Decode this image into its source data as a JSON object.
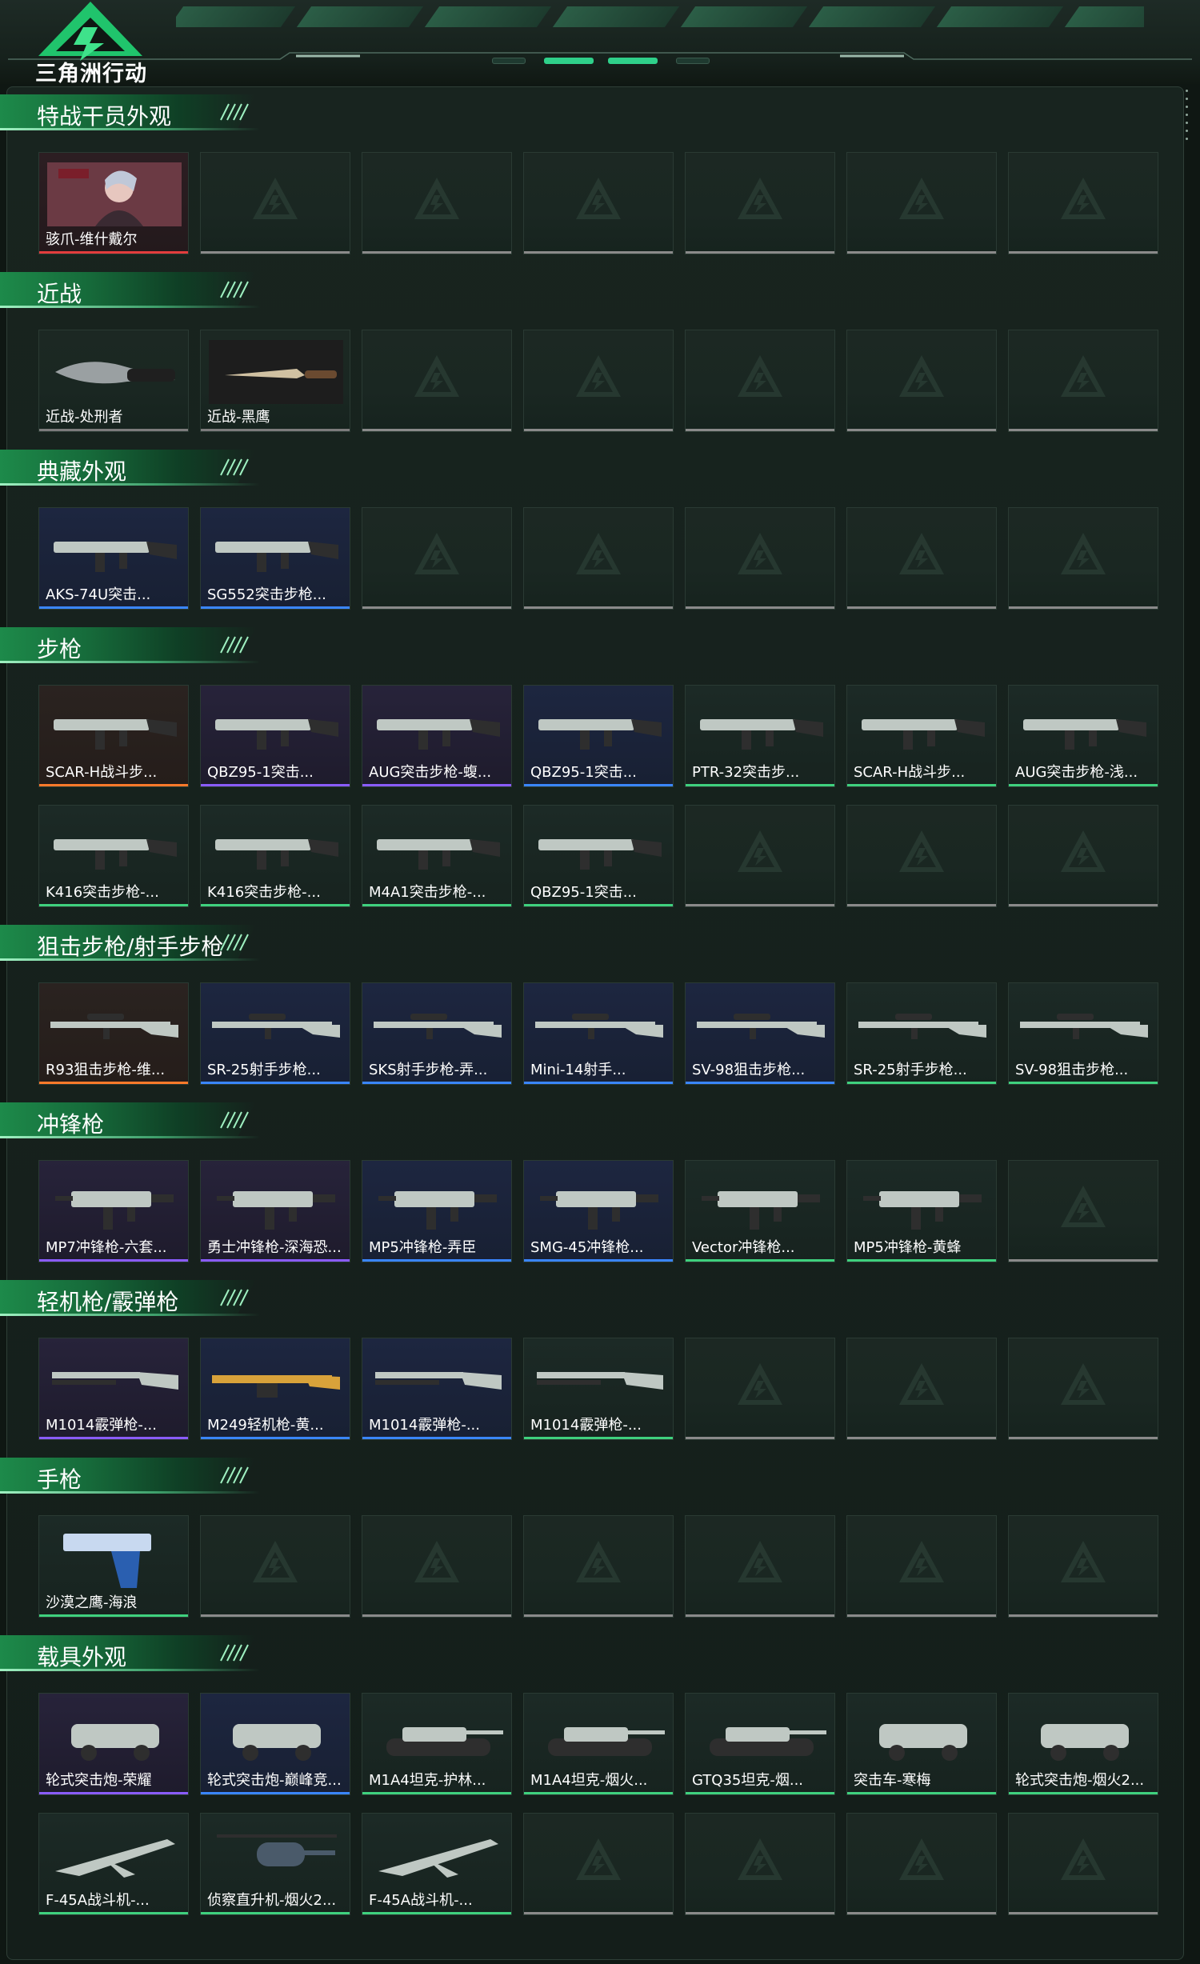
{
  "app": {
    "logo_text": "三角洲行动",
    "accent": "#2fd08a"
  },
  "sections": [
    {
      "title": "特战干员外观",
      "rows": [
        [
          {
            "name": "骇爪-维什戴尔",
            "quality": "red",
            "icon": "operator-portrait"
          },
          null,
          null,
          null,
          null,
          null,
          null
        ]
      ]
    },
    {
      "title": "近战",
      "rows": [
        [
          {
            "name": "近战-处刑者",
            "quality": "none",
            "icon": "melee-blade"
          },
          {
            "name": "近战-黑鹰",
            "quality": "none",
            "icon": "knife"
          },
          null,
          null,
          null,
          null,
          null
        ]
      ]
    },
    {
      "title": "典藏外观",
      "rows": [
        [
          {
            "name": "AKS-74U突击...",
            "quality": "blue",
            "icon": "rifle"
          },
          {
            "name": "SG552突击步枪...",
            "quality": "blue",
            "icon": "rifle"
          },
          null,
          null,
          null,
          null,
          null
        ]
      ]
    },
    {
      "title": "步枪",
      "rows": [
        [
          {
            "name": "SCAR-H战斗步...",
            "quality": "orange",
            "icon": "rifle"
          },
          {
            "name": "QBZ95-1突击...",
            "quality": "purple",
            "icon": "rifle"
          },
          {
            "name": "AUG突击步枪-蝮...",
            "quality": "purple",
            "icon": "rifle"
          },
          {
            "name": "QBZ95-1突击...",
            "quality": "blue",
            "icon": "rifle"
          },
          {
            "name": "PTR-32突击步...",
            "quality": "green",
            "icon": "rifle"
          },
          {
            "name": "SCAR-H战斗步...",
            "quality": "green",
            "icon": "rifle"
          },
          {
            "name": "AUG突击步枪-浅...",
            "quality": "green",
            "icon": "rifle"
          }
        ],
        [
          {
            "name": "K416突击步枪-...",
            "quality": "green",
            "icon": "rifle"
          },
          {
            "name": "K416突击步枪-...",
            "quality": "green",
            "icon": "rifle"
          },
          {
            "name": "M4A1突击步枪-...",
            "quality": "green",
            "icon": "rifle"
          },
          {
            "name": "QBZ95-1突击...",
            "quality": "green",
            "icon": "rifle"
          },
          null,
          null,
          null
        ]
      ]
    },
    {
      "title": "狙击步枪/射手步枪",
      "rows": [
        [
          {
            "name": "R93狙击步枪-维...",
            "quality": "orange",
            "icon": "sniper"
          },
          {
            "name": "SR-25射手步枪...",
            "quality": "blue",
            "icon": "sniper"
          },
          {
            "name": "SKS射手步枪-弄...",
            "quality": "blue",
            "icon": "sniper"
          },
          {
            "name": "Mini-14射手...",
            "quality": "blue",
            "icon": "sniper"
          },
          {
            "name": "SV-98狙击步枪...",
            "quality": "blue",
            "icon": "sniper"
          },
          {
            "name": "SR-25射手步枪...",
            "quality": "green",
            "icon": "sniper"
          },
          {
            "name": "SV-98狙击步枪...",
            "quality": "green",
            "icon": "sniper"
          }
        ]
      ]
    },
    {
      "title": "冲锋枪",
      "rows": [
        [
          {
            "name": "MP7冲锋枪-六套...",
            "quality": "purple",
            "icon": "smg"
          },
          {
            "name": "勇士冲锋枪-深海恐...",
            "quality": "purple",
            "icon": "smg"
          },
          {
            "name": "MP5冲锋枪-弄臣",
            "quality": "blue",
            "icon": "smg"
          },
          {
            "name": "SMG-45冲锋枪...",
            "quality": "blue",
            "icon": "smg"
          },
          {
            "name": "Vector冲锋枪...",
            "quality": "green",
            "icon": "smg"
          },
          {
            "name": "MP5冲锋枪-黄蜂",
            "quality": "green",
            "icon": "smg"
          },
          null
        ]
      ]
    },
    {
      "title": "轻机枪/霰弹枪",
      "rows": [
        [
          {
            "name": "M1014霰弹枪-...",
            "quality": "purple",
            "icon": "shotgun"
          },
          {
            "name": "M249轻机枪-黄...",
            "quality": "blue",
            "icon": "lmg"
          },
          {
            "name": "M1014霰弹枪-...",
            "quality": "blue",
            "icon": "shotgun"
          },
          {
            "name": "M1014霰弹枪-...",
            "quality": "green",
            "icon": "shotgun"
          },
          null,
          null,
          null
        ]
      ]
    },
    {
      "title": "手枪",
      "rows": [
        [
          {
            "name": "沙漠之鹰-海浪",
            "quality": "green",
            "icon": "pistol"
          },
          null,
          null,
          null,
          null,
          null,
          null
        ]
      ]
    },
    {
      "title": "载具外观",
      "rows": [
        [
          {
            "name": "轮式突击炮-荣耀",
            "quality": "purple",
            "icon": "vehicle"
          },
          {
            "name": "轮式突击炮-巅峰竞...",
            "quality": "blue",
            "icon": "vehicle"
          },
          {
            "name": "M1A4坦克-护林...",
            "quality": "green",
            "icon": "tank"
          },
          {
            "name": "M1A4坦克-烟火...",
            "quality": "green",
            "icon": "tank"
          },
          {
            "name": "GTQ35坦克-烟...",
            "quality": "green",
            "icon": "tank"
          },
          {
            "name": "突击车-寒梅",
            "quality": "green",
            "icon": "vehicle"
          },
          {
            "name": "轮式突击炮-烟火2...",
            "quality": "green",
            "icon": "vehicle"
          }
        ],
        [
          {
            "name": "F-45A战斗机-...",
            "quality": "green",
            "icon": "jet"
          },
          {
            "name": "侦察直升机-烟火2...",
            "quality": "green",
            "icon": "helicopter"
          },
          {
            "name": "F-45A战斗机-...",
            "quality": "green",
            "icon": "jet"
          },
          null,
          null,
          null,
          null
        ]
      ]
    }
  ]
}
